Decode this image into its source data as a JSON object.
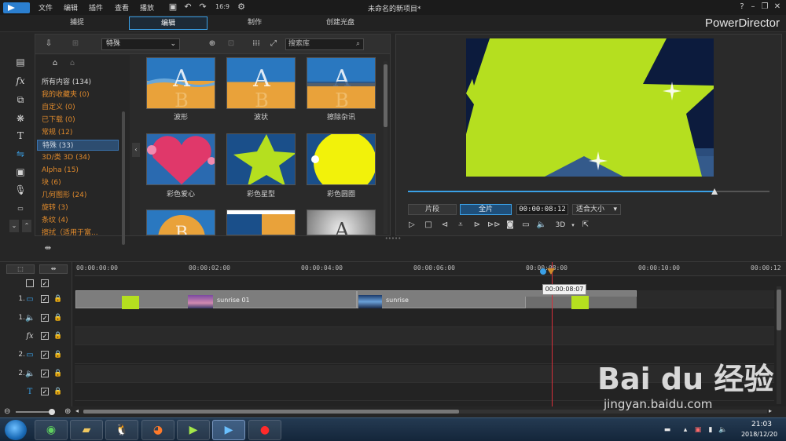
{
  "titlebar": {
    "menus": [
      "文件",
      "编辑",
      "插件",
      "查看",
      "播放"
    ],
    "doc_title": "未命名的新项目*",
    "help": "?"
  },
  "modes": {
    "tabs": [
      "捕捉",
      "编辑",
      "制作",
      "创建光盘"
    ],
    "active": "编辑",
    "brand": "PowerDirector"
  },
  "library": {
    "category_selected": "特殊",
    "search_placeholder": "搜索库",
    "categories": [
      {
        "label": "所有内容 (134)",
        "kind": "all"
      },
      {
        "label": "我的收藏夹 (0)"
      },
      {
        "label": "自定义 (0)"
      },
      {
        "label": "已下载 (0)"
      },
      {
        "label": "常规 (12)"
      },
      {
        "label": "特殊 (33)",
        "selected": true
      },
      {
        "label": "3D/类 3D (34)"
      },
      {
        "label": "Alpha (15)"
      },
      {
        "label": "块 (6)"
      },
      {
        "label": "几何图形 (24)"
      },
      {
        "label": "旋转 (3)"
      },
      {
        "label": "条纹 (4)"
      },
      {
        "label": "擦拭（适用于富..."
      }
    ],
    "transitions": [
      {
        "label": "波形"
      },
      {
        "label": "波状"
      },
      {
        "label": "擦除杂讯"
      },
      {
        "label": "彩色爱心"
      },
      {
        "label": "彩色星型"
      },
      {
        "label": "彩色圆圈"
      }
    ]
  },
  "preview": {
    "tab_clip": "片段",
    "tab_movie": "全片",
    "active_tab": "全片",
    "timecode": "00:00:08:12",
    "fit": "适合大小",
    "mode_3d": "3D",
    "progress": 0.848
  },
  "timeline": {
    "ruler": [
      "00:00:00:00",
      "00:00:02:00",
      "00:00:04:00",
      "00:00:06:00",
      "00:00:08:00",
      "00:00:10:00",
      "00:00:12"
    ],
    "tooltip": "00:00:08:07",
    "tracks": [
      {
        "num": "1.",
        "type": "video"
      },
      {
        "num": "1.",
        "type": "audio"
      },
      {
        "num": "",
        "type": "fx"
      },
      {
        "num": "2.",
        "type": "video"
      },
      {
        "num": "2.",
        "type": "audio"
      },
      {
        "num": "",
        "type": "title"
      }
    ],
    "clips": [
      {
        "label": "sunrise 01"
      },
      {
        "label": "sunrise"
      }
    ]
  },
  "taskbar": {
    "time": "21:03",
    "date": "2018/12/20"
  },
  "watermark": {
    "logo": "Bai du 经验",
    "url": "jingyan.baidu.com"
  },
  "colors": {
    "accent": "#3aa0e6",
    "category_text": "#e08a2c",
    "playhead": "#d6303a",
    "star_green": "#b5df1f"
  }
}
